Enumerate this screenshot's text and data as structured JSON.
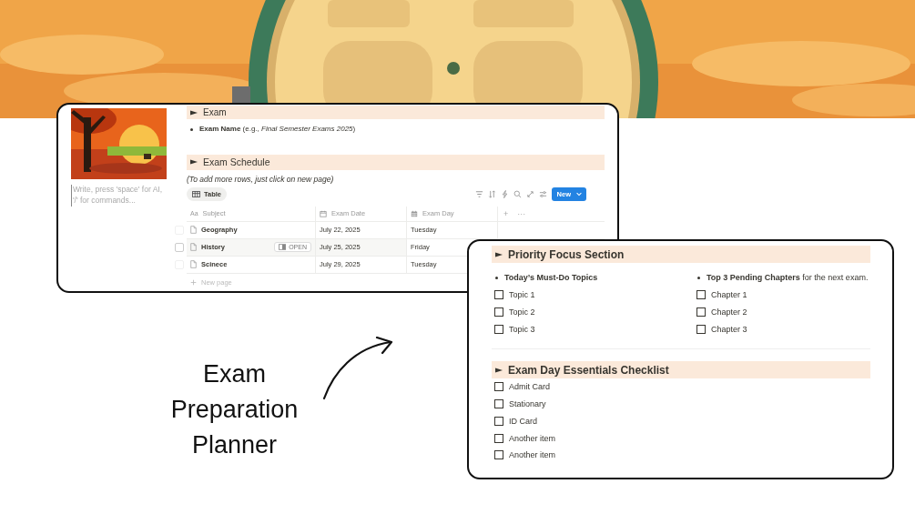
{
  "schedule_card": {
    "editor_placeholder": "Write, press 'space' for AI, '/' for commands...",
    "exam_section": {
      "heading": "Exam",
      "bullet": "**Exam Name** (e.g., *Final Semester Exams 2025*)"
    },
    "schedule": {
      "heading": "Exam Schedule",
      "note": "(To add more rows, just click on new page)",
      "view_tab": "Table",
      "new_button": "New",
      "columns": [
        {
          "label": "Subject",
          "kind": "title",
          "icon_text": "Aa"
        },
        {
          "label": "Exam Date",
          "kind": "date"
        },
        {
          "label": "Exam Day",
          "kind": "formula"
        }
      ],
      "add_column": "+",
      "more": "···",
      "open_label": "OPEN",
      "rows": [
        {
          "subject": "Geography",
          "date": "July 22, 2025",
          "day": "Tuesday",
          "hovered": false,
          "checked": false
        },
        {
          "subject": "History",
          "date": "July 25, 2025",
          "day": "Friday",
          "hovered": true,
          "checked": false
        },
        {
          "subject": "Scinece",
          "date": "July 29, 2025",
          "day": "Tuesday",
          "hovered": false,
          "checked": false
        }
      ],
      "add_row": "New page"
    }
  },
  "caption": "Exam Preparation Planner",
  "focus_card": {
    "priority": {
      "heading": "Priority Focus Section",
      "columns": [
        {
          "bullet": "**Today’s Must-Do Topics**",
          "tasks": [
            {
              "label": "Topic 1",
              "checked": false
            },
            {
              "label": "Topic 2",
              "checked": false
            },
            {
              "label": "Topic 3",
              "checked": false
            }
          ]
        },
        {
          "bullet": "**Top 3 Pending Chapters** for the next exam.",
          "tasks": [
            {
              "label": "Chapter 1",
              "checked": false
            },
            {
              "label": "Chapter 2",
              "checked": false
            },
            {
              "label": "Chapter 3",
              "checked": false
            }
          ]
        }
      ]
    },
    "checklist": {
      "heading": "Exam Day Essentials Checklist",
      "tasks": [
        {
          "label": "Admit Card",
          "checked": false
        },
        {
          "label": "Stationary",
          "checked": false
        },
        {
          "label": "ID Card",
          "checked": false
        },
        {
          "label": "Another item",
          "checked": false
        },
        {
          "label": "Another item",
          "checked": false
        }
      ]
    }
  }
}
